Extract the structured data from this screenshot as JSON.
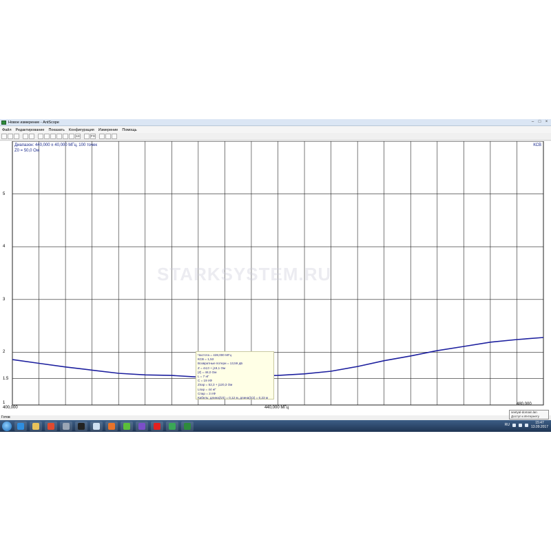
{
  "window": {
    "title": "Новое измерение - AntScope",
    "controls": [
      "–",
      "□",
      "×"
    ]
  },
  "menu": [
    "Файл",
    "Редактирование",
    "Показать",
    "Конфигурация",
    "Измерение",
    "Помощь"
  ],
  "toolbar": {
    "buttons": [
      "new-doc-icon",
      "open-folder-icon",
      "save-icon",
      "export-icon",
      "undo-icon",
      "copy-icon",
      "paste-icon",
      "print-icon",
      "chart-icon",
      "settings-icon",
      "refresh-icon",
      "number-icon",
      "filter-icon",
      "fg-icon",
      "scale-icon",
      "axes-icon",
      "pen-icon"
    ],
    "labels": {
      "number": "123",
      "fg": "FG"
    }
  },
  "plot": {
    "range_label": "Диапазон: 440,000 ± 40,000 МГц, 100 точек",
    "z0_label": "Z0 = 50,0 Ом",
    "param_label": "КСВ",
    "watermark": "STARKSYSTEM.RU",
    "curve_color": "#1c1f9e",
    "grid_color": "#222222"
  },
  "chart_data": {
    "type": "line",
    "x_unit": "МГц",
    "xlim": [
      400,
      480
    ],
    "ylim": [
      1,
      6
    ],
    "y_ticks": [
      1,
      1.5,
      2,
      3,
      4,
      5
    ],
    "y_tick_labels": [
      "1",
      "1.5",
      "2",
      "3",
      "4",
      "5"
    ],
    "x_tick_labels": [
      "400,000",
      "440,000 МГц",
      "480,000"
    ],
    "x": [
      400,
      404,
      408,
      412,
      416,
      420,
      424,
      428,
      432,
      436,
      440,
      444,
      448,
      452,
      456,
      460,
      464,
      468,
      472,
      476,
      480
    ],
    "y": [
      1.86,
      1.79,
      1.72,
      1.66,
      1.6,
      1.57,
      1.56,
      1.53,
      1.54,
      1.55,
      1.56,
      1.59,
      1.64,
      1.73,
      1.84,
      1.93,
      2.03,
      2.11,
      2.19,
      2.24,
      2.28
    ]
  },
  "tooltip": {
    "lines": [
      "Частота = 428,000 МГц",
      "КСВ = 1,53",
      "Возвратные потери = 13,59 дБ",
      "Z = 44,0 + j19,1 Ом",
      "|Z| = 48,0 Ом",
      "L = 7 нГ",
      "C = 19 пФ",
      "Zпар = 52,3 + j120,3 Ом",
      "Lпар = 44 нГ",
      "Cпар = 3 пФ",
      "Кабель: длина(λ/4) = 0,12 м, длина(λ/2) = 0,23 м"
    ]
  },
  "status": {
    "text": "Готов"
  },
  "taskbar": {
    "apps": [
      {
        "name": "ie-icon",
        "color": "#2f8ee0"
      },
      {
        "name": "photos-icon",
        "color": "#e8c35a"
      },
      {
        "name": "media-player-icon",
        "color": "#e04a2f"
      },
      {
        "name": "settings-app-icon",
        "color": "#9aa6b5"
      },
      {
        "name": "terminal-icon",
        "color": "#222222"
      },
      {
        "name": "notepad-icon",
        "color": "#cfe0f2"
      },
      {
        "name": "firefox-icon",
        "color": "#e8732a"
      },
      {
        "name": "utorrent-icon",
        "color": "#5bbf3a"
      },
      {
        "name": "visual-studio-icon",
        "color": "#7a4fc9"
      },
      {
        "name": "yandex-browser-icon",
        "color": "#e22020"
      },
      {
        "name": "chrome-icon",
        "color": "#3aa757"
      },
      {
        "name": "antscope-icon",
        "color": "#2e8b3c"
      }
    ],
    "lang": "RU",
    "time": "15:47",
    "date": "13.09.2017",
    "notification": [
      "seetyal-domain.lan",
      "Доступ к Интернету"
    ]
  }
}
